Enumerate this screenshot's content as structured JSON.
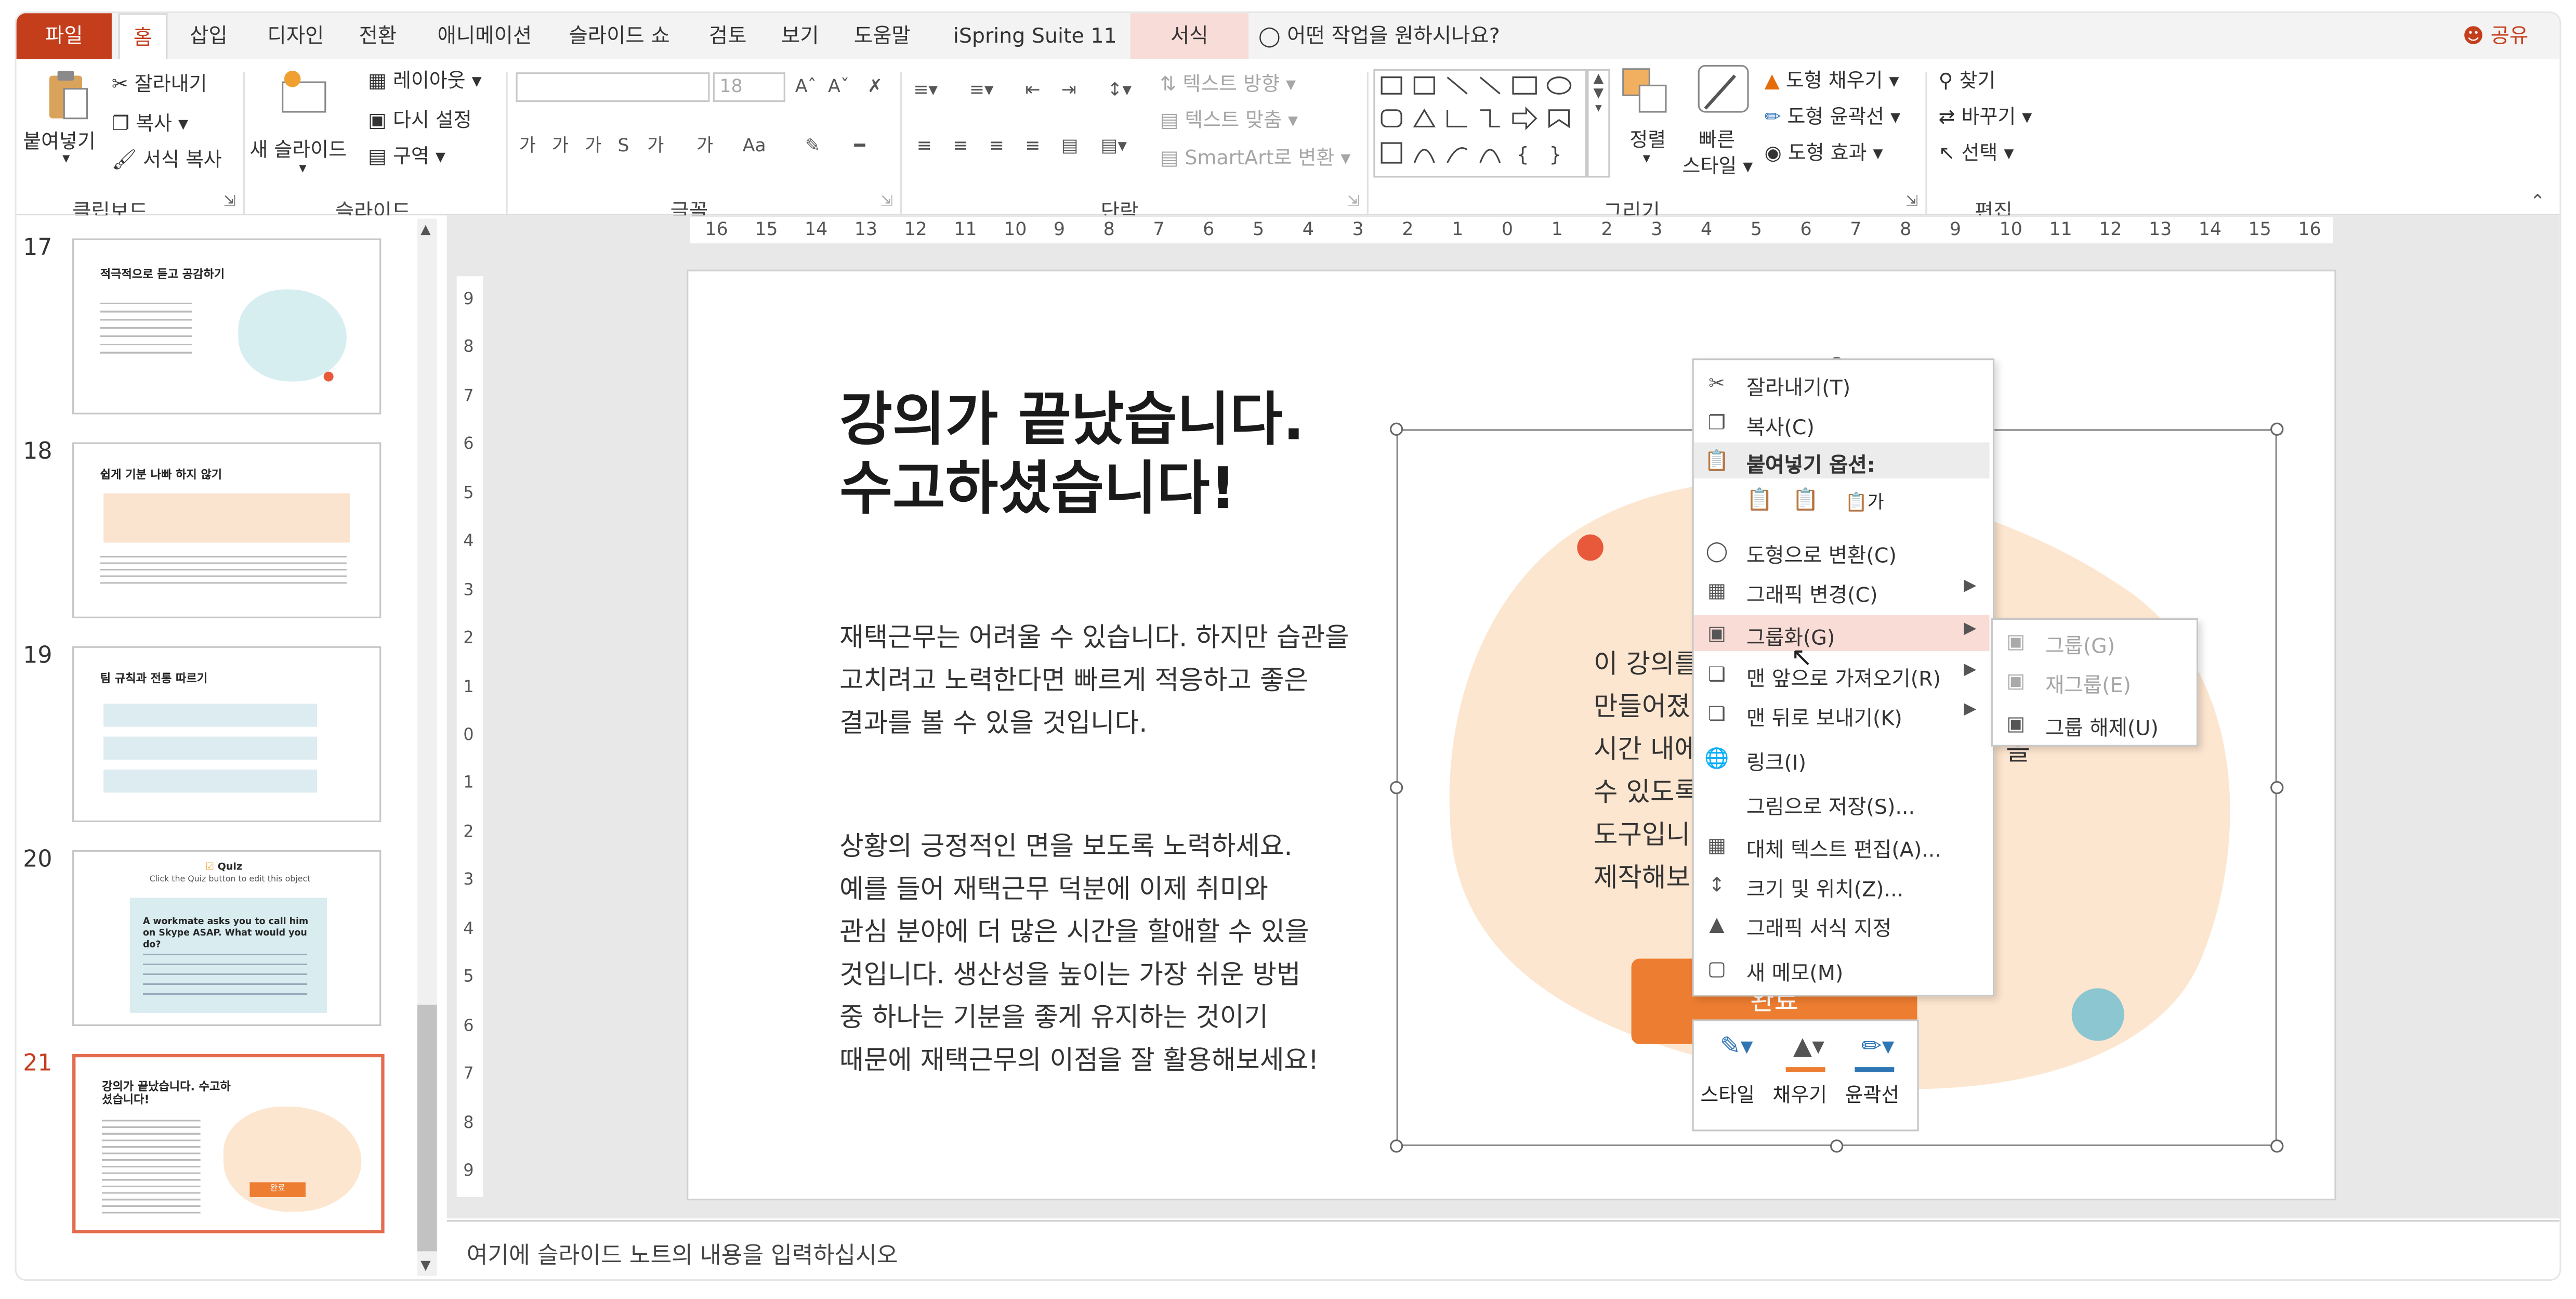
{
  "menubar": {
    "tabs": [
      "파일",
      "홈",
      "삽입",
      "디자인",
      "전환",
      "애니메이션",
      "슬라이드 쇼",
      "검토",
      "보기",
      "도움말",
      "iSpring Suite 11",
      "서식"
    ],
    "search": "어떤 작업을 원하시나요?",
    "share": "공유"
  },
  "ribbon": {
    "paste": "붙여넣기",
    "cut": "잘라내기",
    "copy": "복사",
    "format_painter": "서식 복사",
    "new_slide": "새 슬라이드",
    "layout": "레이아웃",
    "reset": "다시 설정",
    "section": "구역",
    "font_size": "18",
    "text_direction": "텍스트 방향",
    "align_text": "텍스트 맞춤",
    "smartart": "SmartArt로 변환",
    "arrange": "정렬",
    "quick_styles_1": "빠른",
    "quick_styles_2": "스타일",
    "shape_fill": "도형 채우기",
    "shape_outline": "도형 윤곽선",
    "shape_effects": "도형 효과",
    "find": "찾기",
    "replace": "바꾸기",
    "select": "선택",
    "groups": [
      "클립보드",
      "슬라이드",
      "글꼴",
      "단락",
      "그리기",
      "편집"
    ],
    "font_small_labels": [
      "가",
      "가",
      "가",
      "S",
      "가",
      "가",
      "Aa"
    ]
  },
  "slides": [
    {
      "num": "17",
      "title": "적극적으로 듣고 공감하기"
    },
    {
      "num": "18",
      "title": "쉽게 기분 나빠 하지 않기"
    },
    {
      "num": "19",
      "title": "팀 규칙과 전통 따르기"
    },
    {
      "num": "20",
      "title": "Quiz",
      "subtitle": "Click the Quiz button to edit this object",
      "question": "A workmate asks you to call him on Skype ASAP. What would you do?"
    },
    {
      "num": "21",
      "title": "강의가 끝났습니다. 수고하셨습니다!",
      "button": "완료"
    }
  ],
  "ruler": {
    "h": [
      "16",
      "15",
      "14",
      "13",
      "12",
      "11",
      "10",
      "9",
      "8",
      "7",
      "6",
      "5",
      "4",
      "3",
      "2",
      "1",
      "0",
      "1",
      "2",
      "3",
      "4",
      "5",
      "6",
      "7",
      "8",
      "9",
      "10",
      "11",
      "12",
      "13",
      "14",
      "15",
      "16"
    ],
    "v": [
      "9",
      "8",
      "7",
      "6",
      "5",
      "4",
      "3",
      "2",
      "1",
      "0",
      "1",
      "2",
      "3",
      "4",
      "5",
      "6",
      "7",
      "8",
      "9"
    ]
  },
  "slide": {
    "title_line1": "강의가 끝났습니다.",
    "title_line2": "수고하셨습니다!",
    "para1": [
      "재택근무는 어려울 수 있습니다. 하지만 습관을",
      "고치려고 노력한다면 빠르게 적응하고 좋은",
      "결과를 볼 수 있을 것입니다."
    ],
    "para2": [
      "상황의 긍정적인 면을 보도록 노력하세요.",
      "예를 들어 재택근무 덕분에 이제 취미와",
      "관심 분야에 더 많은 시간을 할애할 수 있을",
      "것입니다. 생산성을 높이는 가장 쉬운 방법",
      "중 하나는 기분을 좋게 유지하는 것이기",
      "때문에 재택근무의 이점을 잘 활용해보세요!"
    ],
    "right_text": [
      "이 강의를",
      "만들어졌",
      "시간 내에",
      "수 있도록",
      "도구입니",
      "제작해보"
    ],
    "right_text_tail": "을",
    "button": "완료"
  },
  "context_menu": {
    "items": [
      {
        "label": "잘라내기(T)",
        "icon": "scissors-icon"
      },
      {
        "label": "복사(C)",
        "icon": "copy-icon"
      },
      {
        "label": "붙여넣기 옵션:",
        "icon": "paste-icon"
      },
      {
        "label": "도형으로 변환(C)",
        "icon": "convert-shape-icon"
      },
      {
        "label": "그래픽 변경(C)",
        "icon": "change-graphic-icon"
      },
      {
        "label": "그룹화(G)",
        "icon": "group-icon"
      },
      {
        "label": "맨 앞으로 가져오기(R)",
        "icon": "bring-front-icon"
      },
      {
        "label": "맨 뒤로 보내기(K)",
        "icon": "send-back-icon"
      },
      {
        "label": "링크(I)",
        "icon": "link-icon"
      },
      {
        "label": "그림으로 저장(S)...",
        "icon": ""
      },
      {
        "label": "대체 텍스트 편집(A)...",
        "icon": "alt-text-icon"
      },
      {
        "label": "크기 및 위치(Z)...",
        "icon": "size-position-icon"
      },
      {
        "label": "그래픽 서식 지정",
        "icon": "format-graphic-icon"
      },
      {
        "label": "새 메모(M)",
        "icon": "comment-icon"
      }
    ],
    "paste_option_text": "가"
  },
  "submenu": {
    "items": [
      "그룹(G)",
      "재그룹(E)",
      "그룹 해제(U)"
    ]
  },
  "mini_toolbar": {
    "style": "스타일",
    "fill": "채우기",
    "outline": "윤곽선"
  },
  "notes": {
    "placeholder": "여기에 슬라이드 노트의 내용을 입력하십시오"
  },
  "colors": {
    "accent": "#c43e1c",
    "blob": "#fde6d0",
    "button": "#ed7d31",
    "coral": "#e8593c",
    "teal": "#8cc6d0"
  }
}
